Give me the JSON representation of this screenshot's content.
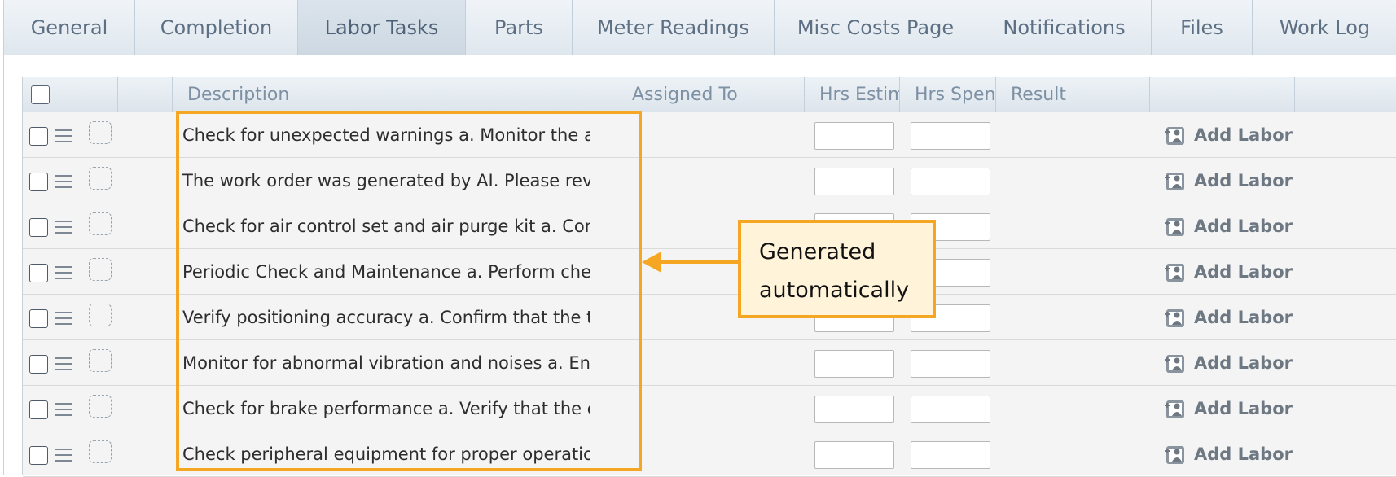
{
  "tabs": [
    {
      "label": "General",
      "active": false
    },
    {
      "label": "Completion",
      "active": false
    },
    {
      "label": "Labor Tasks",
      "active": true
    },
    {
      "label": "Parts",
      "active": false
    },
    {
      "label": "Meter Readings",
      "active": false
    },
    {
      "label": "Misc Costs Page",
      "active": false
    },
    {
      "label": "Notifications",
      "active": false
    },
    {
      "label": "Files",
      "active": false
    },
    {
      "label": "Work Log",
      "active": false
    }
  ],
  "grid": {
    "headers": {
      "description": "Description",
      "assigned_to": "Assigned To",
      "hrs_estimated": "Hrs Estim",
      "hrs_spent": "Hrs Spent",
      "result": "Result"
    },
    "rows": [
      {
        "description": "Check for unexpected warnings a. Monitor the alar…",
        "add_label": "Add Labor"
      },
      {
        "description": "The work order was generated by AI. Please review…",
        "add_label": "Add Labor"
      },
      {
        "description": "Check for air control set and air purge kit a. Confir…",
        "add_label": "Add Labor"
      },
      {
        "description": "Periodic Check and Maintenance a. Perform check a…",
        "add_label": "Add Labor"
      },
      {
        "description": "Verify positioning accuracy a. Confirm that the taug…",
        "add_label": "Add Labor"
      },
      {
        "description": "Monitor for abnormal vibration and noises a. Ensure…",
        "add_label": "Add Labor"
      },
      {
        "description": "Check for brake performance a. Verify that the end …",
        "add_label": "Add Labor"
      },
      {
        "description": "Check peripheral equipment for proper operation a. …",
        "add_label": "Add Labor"
      }
    ]
  },
  "annotation": {
    "callout_text": "Generated\nautomatically",
    "color": "#f5a623",
    "callout_bg": "#fff3da"
  },
  "icons": {
    "row_menu": "menu-icon",
    "row_status": "dashed-square-icon",
    "add_labor": "person-add-icon"
  }
}
